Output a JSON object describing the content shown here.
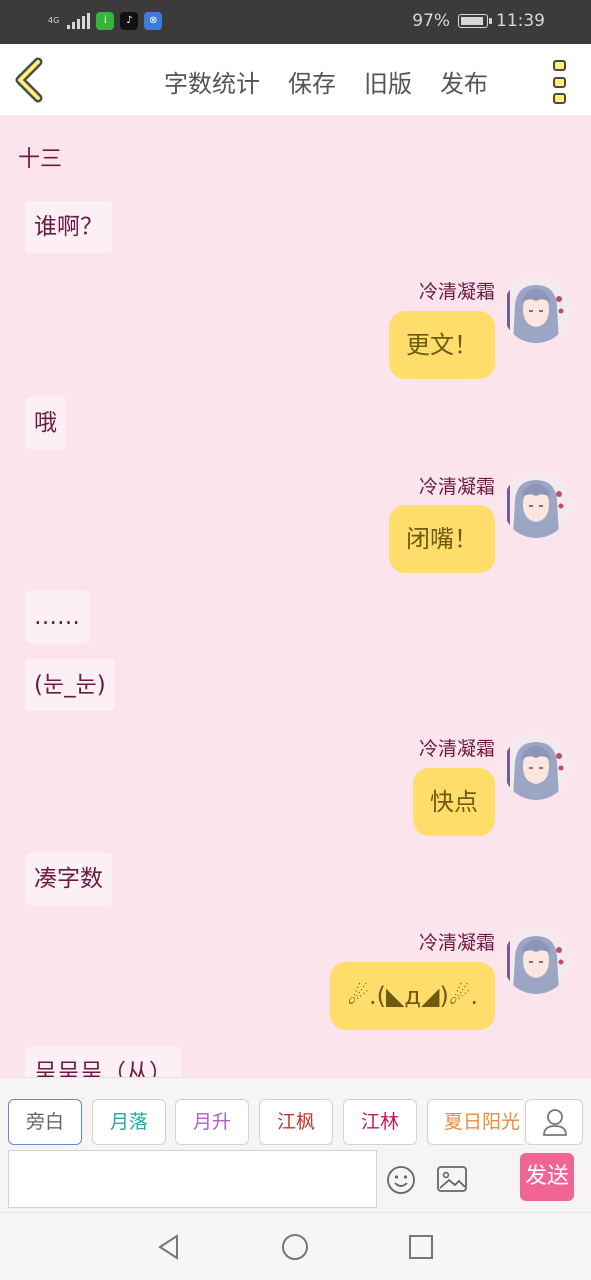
{
  "status_bar": {
    "network": "4G",
    "battery": "97%",
    "time": "11:39",
    "icons": [
      "signal-icon",
      "iqiyi-app-icon",
      "tiktok-app-icon",
      "app-icon"
    ]
  },
  "nav": {
    "back_icon": "chevron-left-icon",
    "actions": [
      "字数统计",
      "保存",
      "旧版",
      "发布"
    ],
    "more_icon": "more-menu-icon"
  },
  "chat": {
    "chapter_title": "十三",
    "messages": [
      {
        "side": "left",
        "text": "谁啊？"
      },
      {
        "side": "right",
        "sender": "冷清凝霜",
        "text": "更文！"
      },
      {
        "side": "left",
        "text": "哦"
      },
      {
        "side": "right",
        "sender": "冷清凝霜",
        "text": "闭嘴！"
      },
      {
        "side": "left",
        "text": "……"
      },
      {
        "side": "left",
        "text": "(눈_눈)"
      },
      {
        "side": "right",
        "sender": "冷清凝霜",
        "text": "快点"
      },
      {
        "side": "left",
        "text": "凑字数"
      },
      {
        "side": "right",
        "sender": "冷清凝霜",
        "text": "☄.(◣д◢)☄."
      },
      {
        "side": "left",
        "text": "呈呈呈（从）"
      }
    ]
  },
  "composer": {
    "roles": [
      {
        "label": "旁白",
        "color": "#666666"
      },
      {
        "label": "月落",
        "color": "#26a9a0"
      },
      {
        "label": "月升",
        "color": "#b05fc6"
      },
      {
        "label": "江枫",
        "color": "#c0392b"
      },
      {
        "label": "江林",
        "color": "#c2185b"
      },
      {
        "label": "夏日阳光",
        "color": "#ef8a3c"
      }
    ],
    "input_value": "",
    "send_label": "发送",
    "icons": [
      "emoji-icon",
      "image-icon",
      "profile-icon"
    ]
  },
  "system_nav": [
    "back-triangle-icon",
    "home-circle-icon",
    "recents-square-icon"
  ],
  "colors": {
    "chat_background": "#fce4ec",
    "right_bubble": "#fedd6b",
    "left_bubble": "#fdf0f5",
    "send_button": "#f16594",
    "text_primary": "#6b1a42"
  }
}
